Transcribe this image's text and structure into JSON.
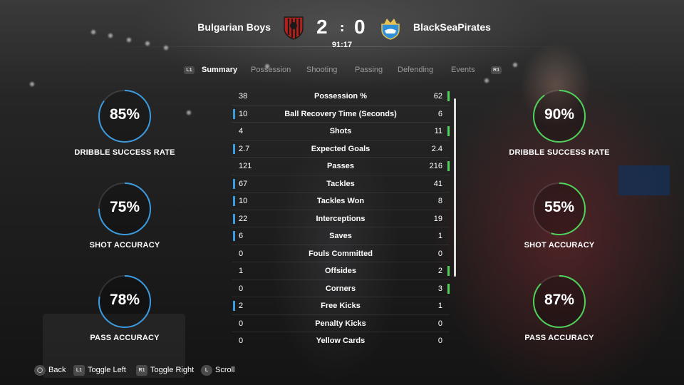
{
  "header": {
    "home_team": "Bulgarian Boys",
    "away_team": "BlackSeaPirates",
    "home_score": "2",
    "away_score": "0",
    "separator": ":",
    "clock": "91:17"
  },
  "colors": {
    "home": "#3a9be0",
    "away": "#4ed35a"
  },
  "tabs": {
    "left_bumper": "L1",
    "right_bumper": "R1",
    "items": [
      "Summary",
      "Possession",
      "Shooting",
      "Passing",
      "Defending",
      "Events"
    ],
    "active": "Summary"
  },
  "home_gauges": [
    {
      "value": "85%",
      "fraction": 0.85,
      "label": "DRIBBLE SUCCESS RATE"
    },
    {
      "value": "75%",
      "fraction": 0.75,
      "label": "SHOT ACCURACY"
    },
    {
      "value": "78%",
      "fraction": 0.78,
      "label": "PASS ACCURACY"
    }
  ],
  "away_gauges": [
    {
      "value": "90%",
      "fraction": 0.9,
      "label": "DRIBBLE SUCCESS RATE"
    },
    {
      "value": "55%",
      "fraction": 0.55,
      "label": "SHOT ACCURACY"
    },
    {
      "value": "87%",
      "fraction": 0.87,
      "label": "PASS ACCURACY"
    }
  ],
  "stats": [
    {
      "label": "Possession %",
      "home": "38",
      "away": "62",
      "leader": "away"
    },
    {
      "label": "Ball Recovery Time (Seconds)",
      "home": "10",
      "away": "6",
      "leader": "home"
    },
    {
      "label": "Shots",
      "home": "4",
      "away": "11",
      "leader": "away"
    },
    {
      "label": "Expected Goals",
      "home": "2.7",
      "away": "2.4",
      "leader": "home"
    },
    {
      "label": "Passes",
      "home": "121",
      "away": "216",
      "leader": "away"
    },
    {
      "label": "Tackles",
      "home": "67",
      "away": "41",
      "leader": "home"
    },
    {
      "label": "Tackles Won",
      "home": "10",
      "away": "8",
      "leader": "home"
    },
    {
      "label": "Interceptions",
      "home": "22",
      "away": "19",
      "leader": "home"
    },
    {
      "label": "Saves",
      "home": "6",
      "away": "1",
      "leader": "home"
    },
    {
      "label": "Fouls Committed",
      "home": "0",
      "away": "0",
      "leader": "none"
    },
    {
      "label": "Offsides",
      "home": "1",
      "away": "2",
      "leader": "away"
    },
    {
      "label": "Corners",
      "home": "0",
      "away": "3",
      "leader": "away"
    },
    {
      "label": "Free Kicks",
      "home": "2",
      "away": "1",
      "leader": "home"
    },
    {
      "label": "Penalty Kicks",
      "home": "0",
      "away": "0",
      "leader": "none"
    },
    {
      "label": "Yellow Cards",
      "home": "0",
      "away": "0",
      "leader": "none"
    }
  ],
  "footer": {
    "back_glyph": "◯",
    "back": "Back",
    "toggle_left_glyph": "L1",
    "toggle_left": "Toggle Left",
    "toggle_right_glyph": "R1",
    "toggle_right": "Toggle Right",
    "scroll_glyph": "L",
    "scroll": "Scroll"
  }
}
